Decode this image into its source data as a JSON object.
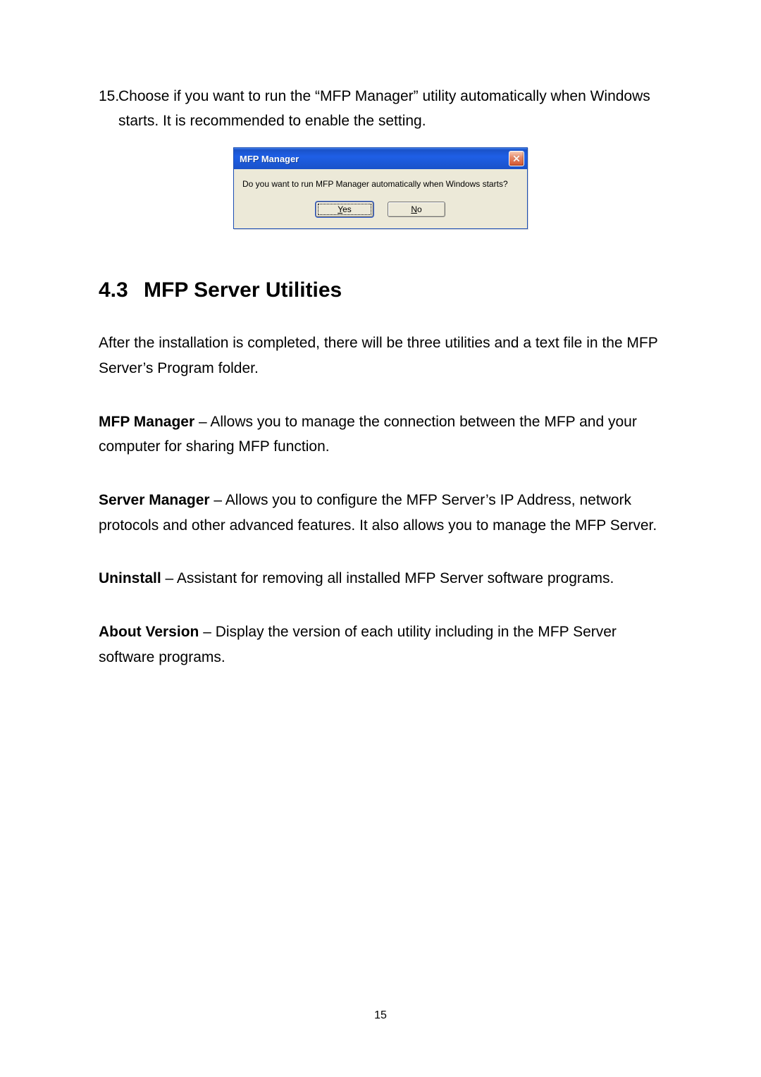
{
  "step": {
    "number": "15.",
    "text": "Choose if you want to run the “MFP Manager” utility automatically when Windows starts. It is recommended to enable the setting."
  },
  "dialog": {
    "title": "MFP Manager",
    "close_glyph": "✕",
    "message": "Do you want to run MFP Manager automatically when Windows starts?",
    "yes_mnemonic": "Y",
    "yes_rest": "es",
    "no_mnemonic": "N",
    "no_rest": "o"
  },
  "section": {
    "number": "4.3",
    "title": "MFP Server Utilities"
  },
  "paras": {
    "intro": "After the installation is completed, there will be three utilities and a text file in the MFP Server’s Program folder.",
    "mfp_label": "MFP Manager",
    "mfp_text": " – Allows you to manage the connection between the MFP and your computer for sharing MFP function.",
    "server_label": "Server Manager",
    "server_text": " – Allows you to configure the MFP Server’s IP Address, network protocols and other advanced features. It also allows you to manage the MFP Server.",
    "uninstall_label": "Uninstall",
    "uninstall_text": " – Assistant for removing all installed MFP Server software programs.",
    "about_label": "About Version",
    "about_text": " – Display the version of each utility including in the MFP Server software programs."
  },
  "page_number": "15"
}
